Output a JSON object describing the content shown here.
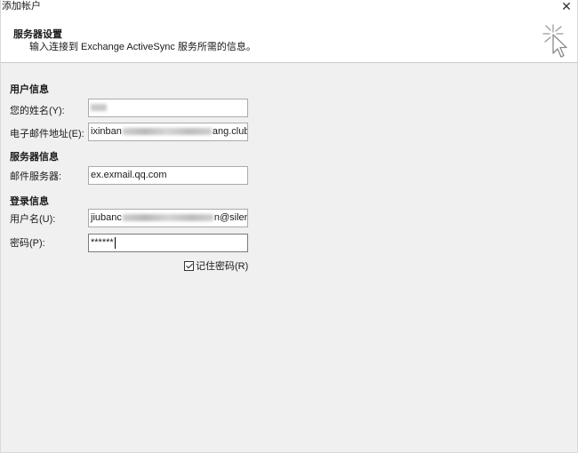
{
  "window": {
    "title": "添加帐户",
    "close_glyph": "✕"
  },
  "header": {
    "title": "服务器设置",
    "subtitle": "输入连接到 Exchange ActiveSync 服务所需的信息。",
    "icon": "cursor-sparkle-icon"
  },
  "user_info": {
    "section_label": "用户信息",
    "name_label": "您的姓名(Y):",
    "email_label": "电子邮件地址(E):",
    "email_prefix": "ixinban",
    "email_suffix": "ang.club"
  },
  "server_info": {
    "section_label": "服务器信息",
    "mail_server_label": "邮件服务器:",
    "mail_server_value": "ex.exmail.qq.com"
  },
  "login_info": {
    "section_label": "登录信息",
    "username_label": "用户名(U):",
    "username_prefix": "jiubanc",
    "username_suffix": "n@silenc",
    "password_label": "密码(P):",
    "password_mask": "******",
    "remember_label": "记住密码(R)",
    "remember_checked": true
  }
}
